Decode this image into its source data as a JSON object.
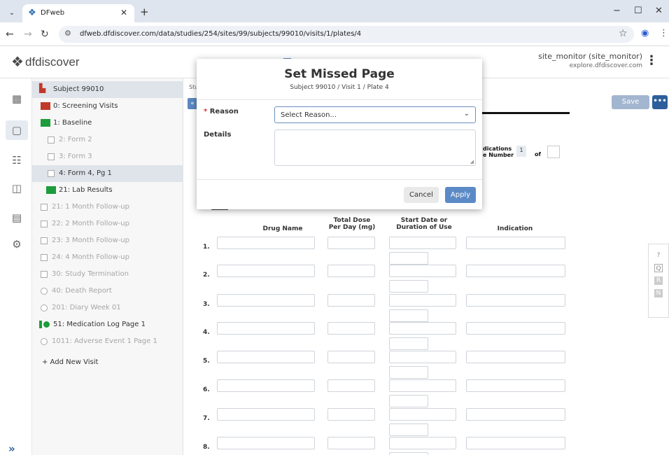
{
  "browser": {
    "tab_title": "DFweb",
    "url": "dfweb.dfdiscover.com/data/studies/254/sites/99/subjects/99010/visits/1/plates/4"
  },
  "header": {
    "logo_text": "dfdiscover",
    "user_name": "site_monitor (site_monitor)",
    "user_host": "explore.dfdiscover.com"
  },
  "tree": {
    "items": [
      {
        "label": "Subject 99010"
      },
      {
        "label": "0: Screening Visits"
      },
      {
        "label": "1: Baseline"
      },
      {
        "label": "2: Form 2"
      },
      {
        "label": "3: Form 3"
      },
      {
        "label": "4: Form 4, Pg 1"
      },
      {
        "label": "21: Lab Results"
      },
      {
        "label": "21: 1 Month Follow-up"
      },
      {
        "label": "22: 2 Month Follow-up"
      },
      {
        "label": "23: 3 Month Follow-up"
      },
      {
        "label": "24: 4 Month Follow-up"
      },
      {
        "label": "30: Study Termination"
      },
      {
        "label": "40: Death Report"
      },
      {
        "label": "201: Diary Week 01"
      },
      {
        "label": "51: Medication Log Page 1"
      },
      {
        "label": "1011: Adverse Event 1 Page 1"
      }
    ],
    "add_visit": "+ Add New Visit"
  },
  "main": {
    "crumb": "Stu",
    "save_label": "Save",
    "more_label": "•••",
    "meds_line1": "dications",
    "meds_line2": "e Number",
    "meds_value": "1",
    "meds_of": "of",
    "columns": [
      "Drug Name",
      "Total Dose\nPer Day (mg)",
      "Start Date or\nDuration of Use",
      "Indication"
    ],
    "rows": [
      "1.",
      "2.",
      "3.",
      "4.",
      "5.",
      "6.",
      "7.",
      "8."
    ]
  },
  "modal": {
    "title": "Set Missed Page",
    "subtitle": "Subject 99010 / Visit 1 / Plate 4",
    "reason_star": "*",
    "reason_label": "Reason",
    "reason_value": "Select Reason...",
    "details_label": "Details",
    "details_value": "",
    "cancel_label": "Cancel",
    "apply_label": "Apply"
  }
}
